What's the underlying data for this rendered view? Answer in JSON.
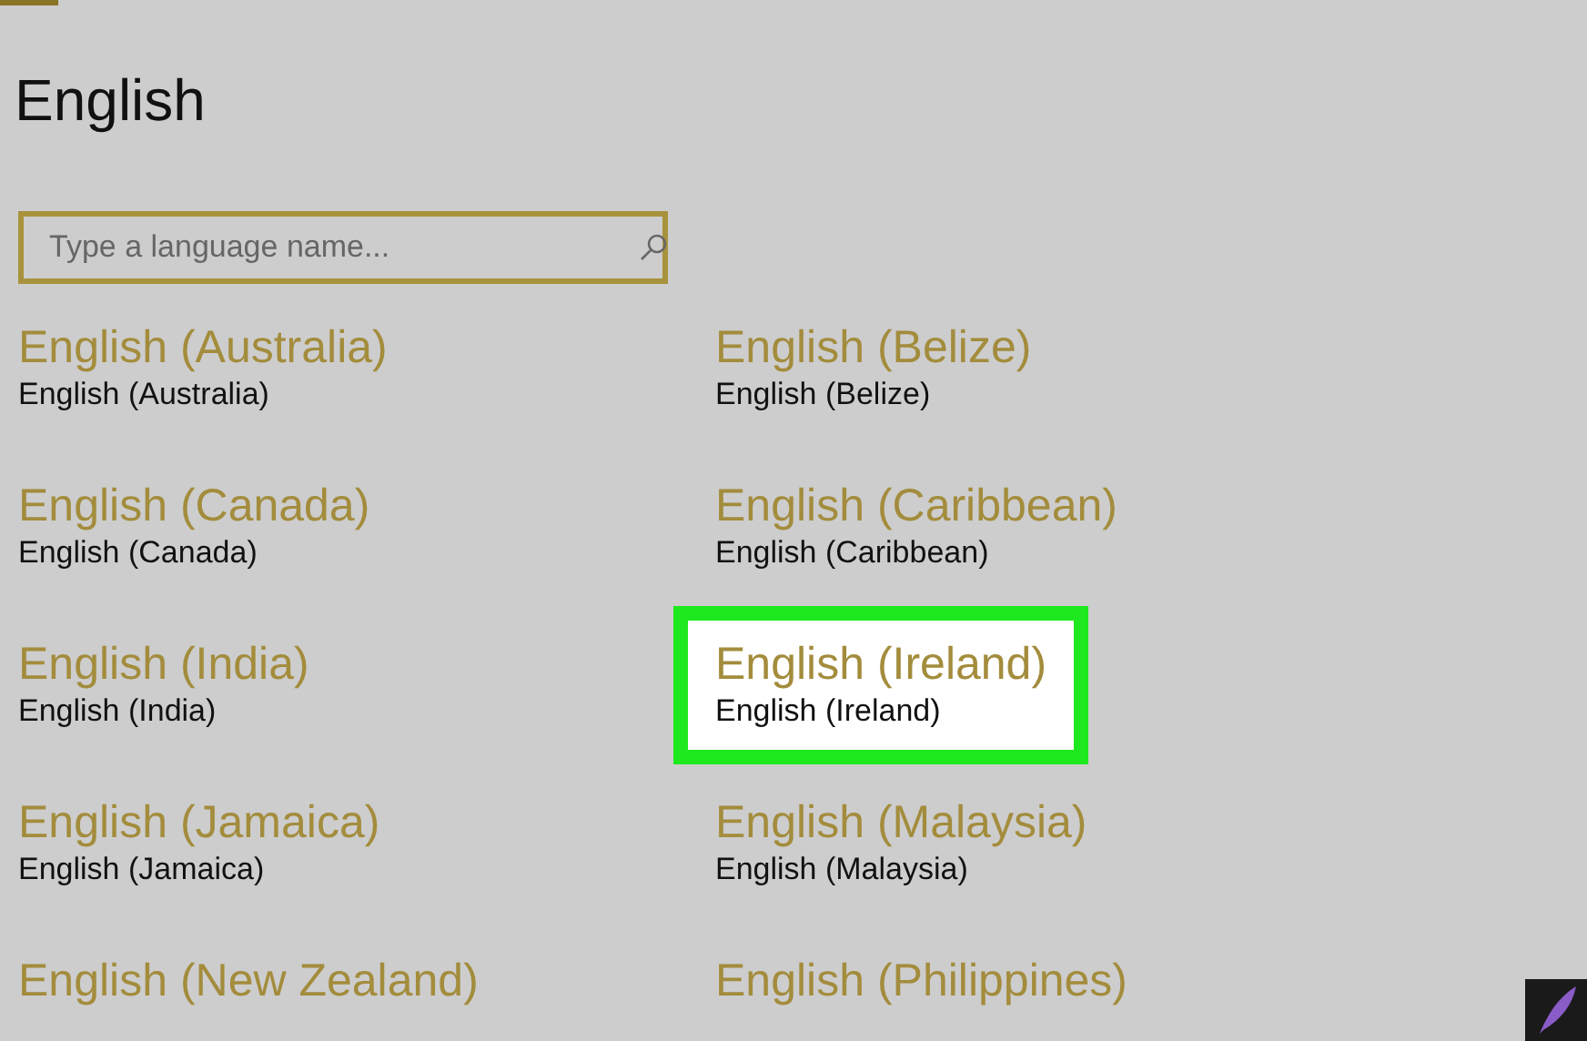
{
  "title": "English",
  "search": {
    "placeholder": "Type a language name..."
  },
  "languages": [
    {
      "name": "English (Australia)",
      "native": "English (Australia)",
      "selected": false
    },
    {
      "name": "English (Belize)",
      "native": "English (Belize)",
      "selected": false
    },
    {
      "name": "English (Canada)",
      "native": "English (Canada)",
      "selected": false
    },
    {
      "name": "English (Caribbean)",
      "native": "English (Caribbean)",
      "selected": false
    },
    {
      "name": "English (India)",
      "native": "English (India)",
      "selected": false
    },
    {
      "name": "English (Ireland)",
      "native": "English (Ireland)",
      "selected": true
    },
    {
      "name": "English (Jamaica)",
      "native": "English (Jamaica)",
      "selected": false
    },
    {
      "name": "English (Malaysia)",
      "native": "English (Malaysia)",
      "selected": false
    },
    {
      "name": "English (New Zealand)",
      "selected": false
    },
    {
      "name": "English (Philippines)",
      "selected": false
    }
  ]
}
